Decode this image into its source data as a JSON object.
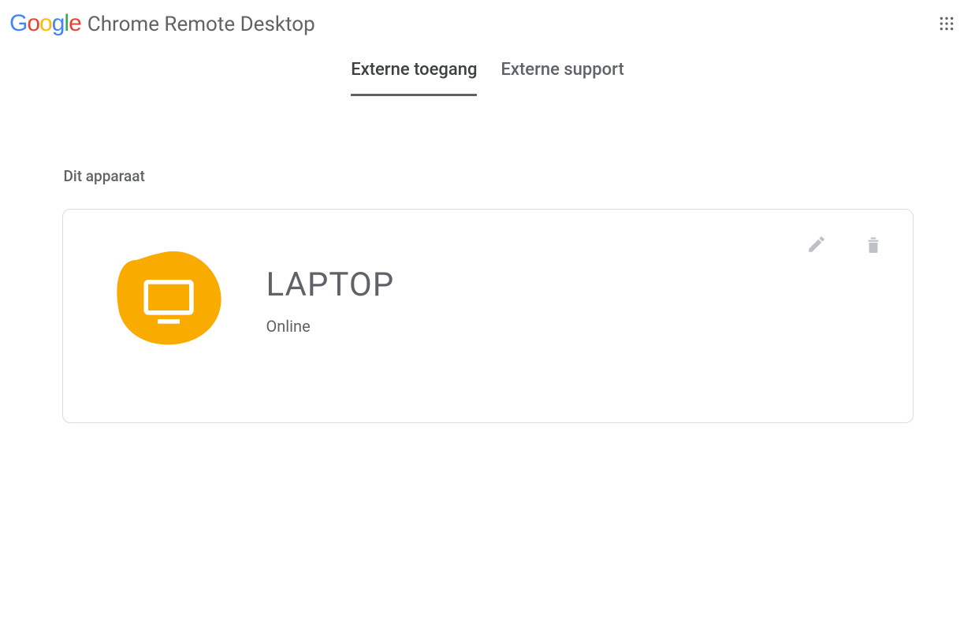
{
  "header": {
    "app_title": "Chrome Remote Desktop"
  },
  "tabs": {
    "items": [
      {
        "label": "Externe toegang",
        "active": true
      },
      {
        "label": "Externe support",
        "active": false
      }
    ]
  },
  "section": {
    "heading": "Dit apparaat"
  },
  "device": {
    "name": "LAPTOP",
    "status": "Online",
    "icon_color": "#F9AB00"
  }
}
